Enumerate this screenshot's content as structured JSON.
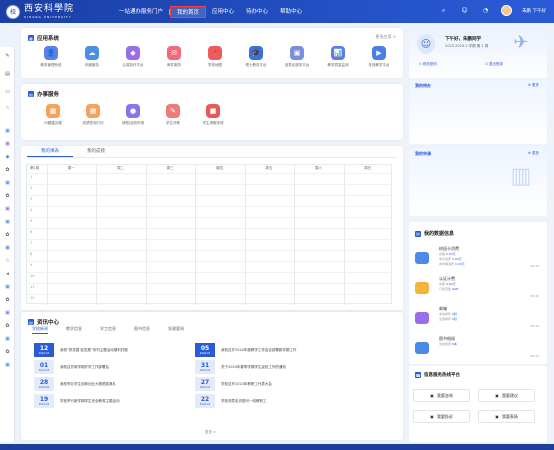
{
  "header": {
    "logo_cn": "西安科學院",
    "logo_en": "XIHANG UNIVERSITY",
    "nav": [
      "一站通办服务门户",
      "我的首页",
      "应用中心",
      "待办中心",
      "帮助中心"
    ],
    "active_nav": "我的首页",
    "username": "朱鹏 下午好"
  },
  "apps": {
    "title": "应用系统",
    "more": "更多应用 >",
    "items": [
      {
        "label": "教务管理系统",
        "icon": "👤",
        "color": "#5f7fe8"
      },
      {
        "label": "网盘服务",
        "icon": "☁",
        "color": "#4a90e2"
      },
      {
        "label": "云端协作平台",
        "icon": "◆",
        "color": "#9a6ee8"
      },
      {
        "label": "邮件服务",
        "icon": "✉",
        "color": "#f06a7a"
      },
      {
        "label": "学校地图",
        "icon": "📍",
        "color": "#ef5a5a"
      },
      {
        "label": "硕士教务平台",
        "icon": "🎓",
        "color": "#3c6fd8"
      },
      {
        "label": "信息化服务平台",
        "icon": "▣",
        "color": "#7a8ee0"
      },
      {
        "label": "教学质量监测",
        "icon": "📊",
        "color": "#5a7ee8"
      },
      {
        "label": "在线教学平台",
        "icon": "▶",
        "color": "#4a7ee8"
      }
    ]
  },
  "office": {
    "title": "办事服务",
    "items": [
      {
        "label": "问题建议箱",
        "icon": "▦",
        "color": "#f2a35e"
      },
      {
        "label": "成绩查询打印",
        "icon": "▦",
        "color": "#f2a35e"
      },
      {
        "label": "请假/返校申请",
        "icon": "●",
        "color": "#8a74e8"
      },
      {
        "label": "学生评教",
        "icon": "✎",
        "color": "#f07a7a"
      },
      {
        "label": "学生请假申请",
        "icon": "■",
        "color": "#e85a5a"
      }
    ]
  },
  "course": {
    "tabs": [
      "我的课表",
      "我的成绩"
    ],
    "active_tab": "我的课表",
    "week_label": "第1周",
    "days": [
      "周一",
      "周二",
      "周三",
      "周四",
      "周五",
      "周六",
      "周日"
    ],
    "rows": [
      "1",
      "2",
      "3",
      "4",
      "5",
      "6",
      "7",
      "8",
      "9",
      "10",
      "11",
      "12"
    ]
  },
  "news": {
    "title": "资讯中心",
    "tabs": [
      "学校新闻",
      "教学信息",
      "学工信息",
      "图书信息",
      "党政要闻"
    ],
    "active_tab": "学校新闻",
    "items": [
      {
        "day": "12",
        "ym": "2024-03",
        "text": "我校“抓党建 促发展”系列主题活动顺利开展",
        "highlight": true
      },
      {
        "day": "05",
        "ym": "2024-03",
        "text": "我校召开2024年度教学工作会议部署新学期工作",
        "highlight": true
      },
      {
        "day": "01",
        "ym": "2024-03",
        "text": "我校召开新学期开学工作部署会",
        "highlight": false
      },
      {
        "day": "31",
        "ym": "2024-02",
        "text": "关于2024年春季学期学生返校工作的通知",
        "highlight": false
      },
      {
        "day": "28",
        "ym": "2024-02",
        "text": "我校举办学生创新创业大赛颁奖典礼",
        "highlight": false
      },
      {
        "day": "27",
        "ym": "2024-02",
        "text": "学校召开2024年教职工代表大会",
        "highlight": false
      },
      {
        "day": "19",
        "ym": "2024-02",
        "text": "学校举行新学期学生安全教育主题活动",
        "highlight": false
      },
      {
        "day": "22",
        "ym": "2024-02",
        "text": "学校领导走访慰问一线教职工",
        "highlight": false
      }
    ],
    "more": "更多 >"
  },
  "profile": {
    "greeting": "下午好，朱鹏同学",
    "semester": "2025-2026-2 学期 第 1 周",
    "actions": [
      "修改密码",
      "退出登录"
    ]
  },
  "todo": {
    "title": "我的待办",
    "more": "更多"
  },
  "apply": {
    "title": "我的申请",
    "more": "更多"
  },
  "data_info": {
    "title": "我的数据信息",
    "items": [
      {
        "name": "校园卡消费",
        "lines": [
          [
            "余额",
            "0.00元"
          ],
          [
            "本月消费",
            "0.00元"
          ],
          [
            "本学期消费",
            "0.00元"
          ]
        ],
        "date": "08-15",
        "color": "#4a8be8"
      },
      {
        "name": "认证计费",
        "lines": [
          [
            "余额",
            "0.00元"
          ],
          [
            "已用流量",
            "0GB"
          ]
        ],
        "date": "08-15",
        "color": "#f3b43c"
      },
      {
        "name": "邮箱",
        "lines": [
          [
            "未读邮件",
            "0封"
          ],
          [
            "全部邮件",
            "0封"
          ]
        ],
        "date": "08-15",
        "color": "#9a6ee8"
      },
      {
        "name": "图书借阅",
        "lines": [
          [
            "当前借阅",
            "0本"
          ]
        ],
        "date": "08-15",
        "color": "#4a8be8"
      }
    ]
  },
  "services": {
    "title": "信息服务热线平台",
    "buttons": [
      "我要咨询",
      "我要建议",
      "我要投诉",
      "我要表扬"
    ]
  }
}
